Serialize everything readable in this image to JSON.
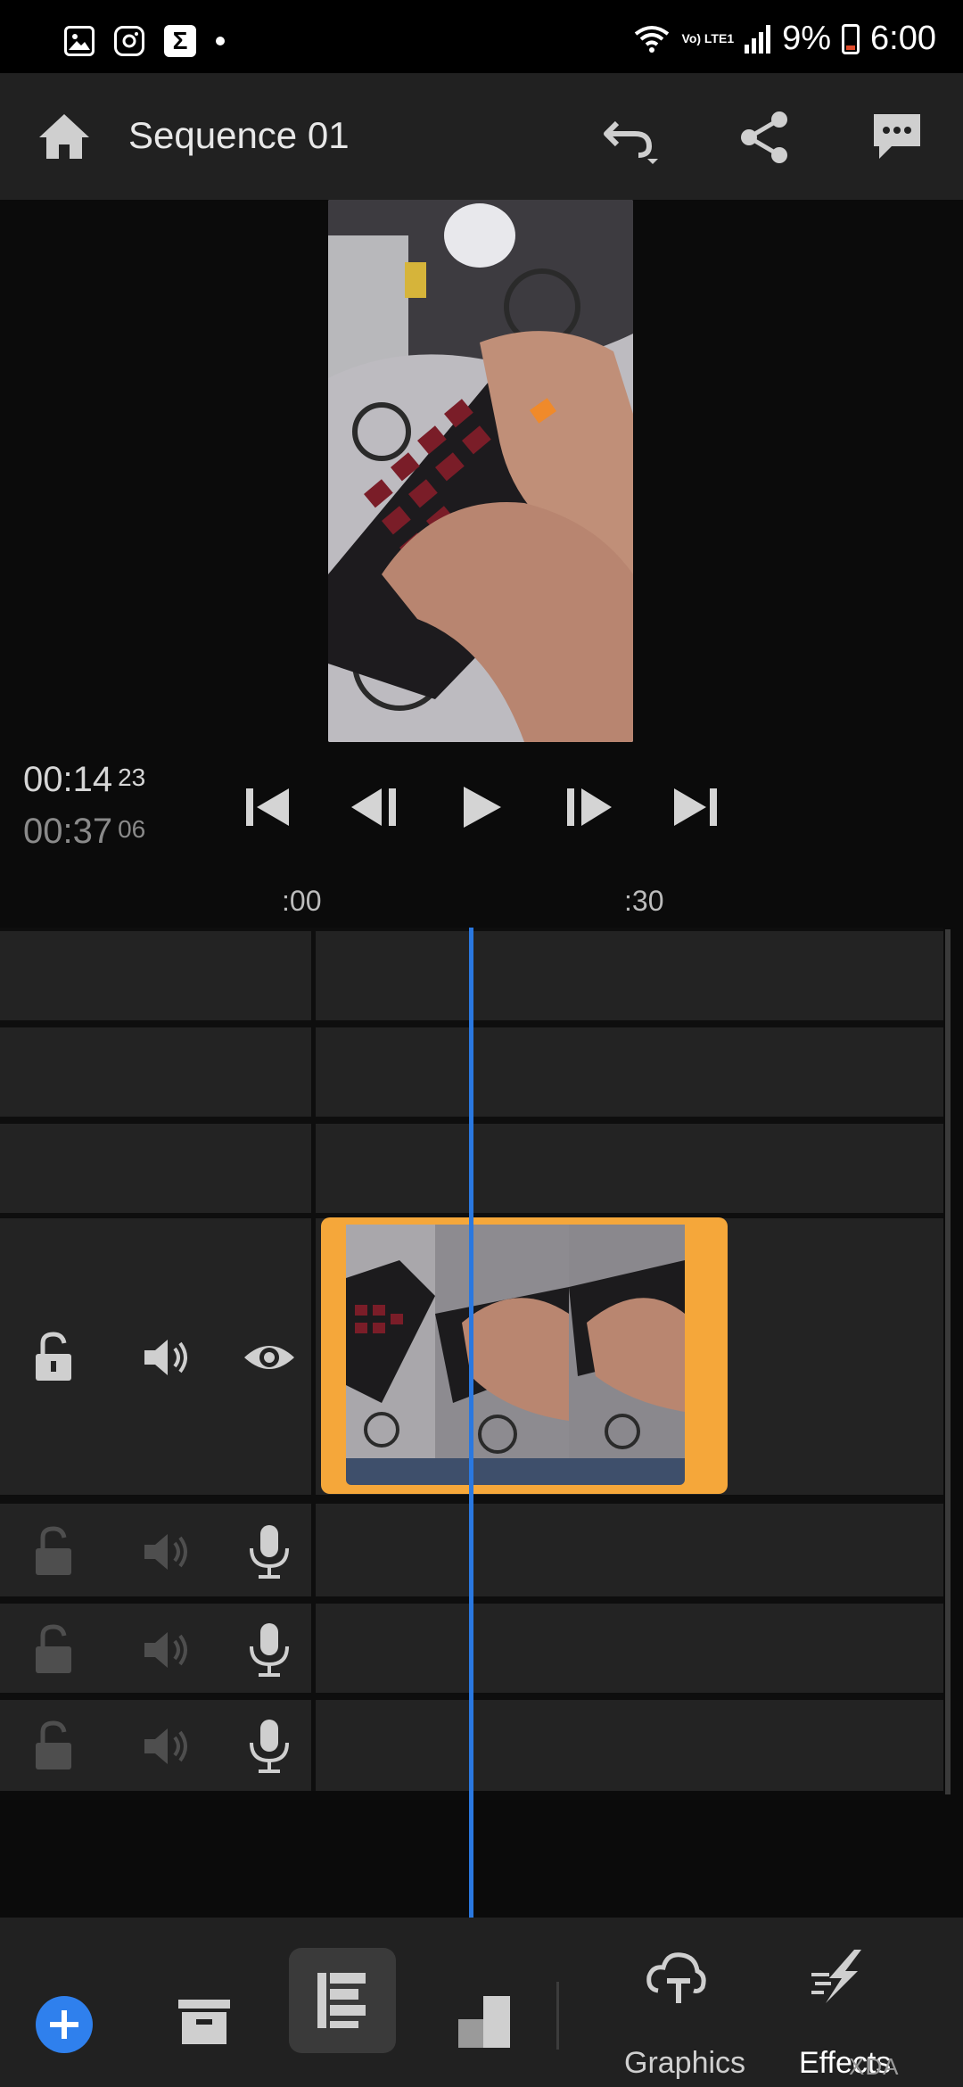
{
  "status_bar": {
    "battery": "9%",
    "time": "6:00",
    "network": "Vo) LTE1"
  },
  "app_bar": {
    "title": "Sequence 01"
  },
  "preview": {
    "current_time": "00:14",
    "current_frame": "23",
    "total_time": "00:37",
    "total_frame": "06"
  },
  "timeline": {
    "ruler_labels": [
      ":00",
      ":30"
    ],
    "clip": {
      "color": "#f5a73a",
      "audio_color": "#3e4f6b"
    },
    "playhead_color": "#2a78e0"
  },
  "bottom_bar": {
    "graphics_label": "Graphics",
    "effects_label": "Effects",
    "accent": "#2f80ed"
  },
  "watermark": "XDA"
}
